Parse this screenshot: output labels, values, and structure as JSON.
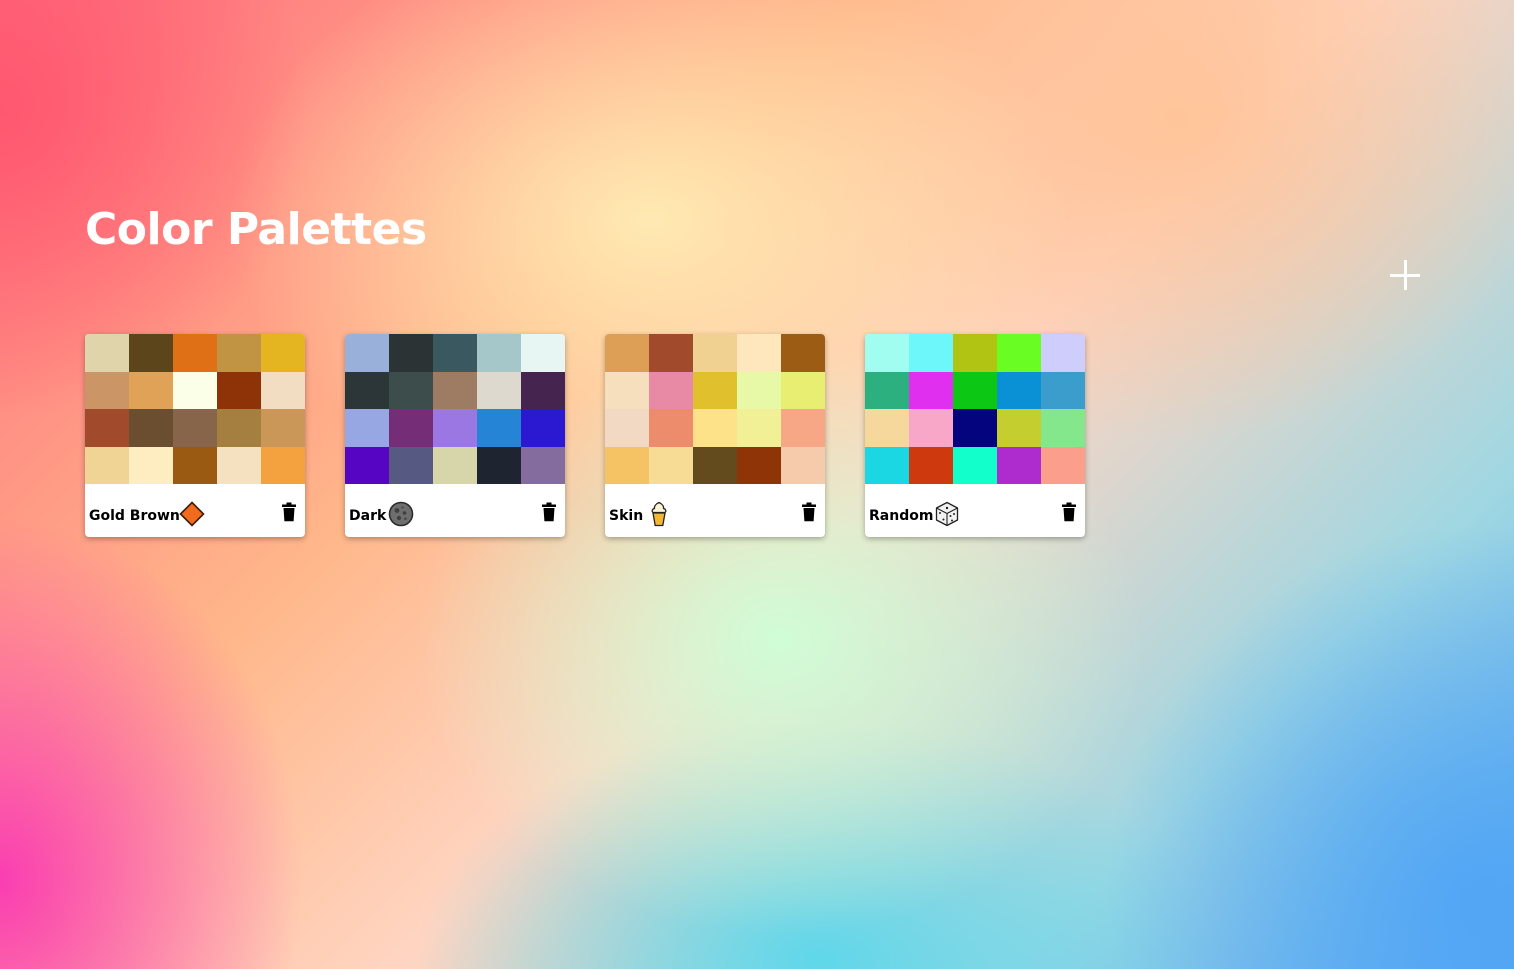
{
  "page": {
    "title": "Color Palettes"
  },
  "toolbar": {
    "add_icon": "plus-icon"
  },
  "palettes": [
    {
      "name": "Gold Brown",
      "emoji": "orange-diamond-icon",
      "colors": [
        "#e0d5aa",
        "#5c451b",
        "#e07016",
        "#c09442",
        "#e4b421",
        "#cb9566",
        "#dfa256",
        "#fbffe8",
        "#8e3308",
        "#f2dcc2",
        "#a24b2c",
        "#6b4e2f",
        "#87654a",
        "#a57f3f",
        "#cb9759",
        "#efd495",
        "#ffedc2",
        "#9a5a11",
        "#f5e0bf",
        "#f4a240"
      ]
    },
    {
      "name": "Dark",
      "emoji": "new-moon-icon",
      "colors": [
        "#98b0da",
        "#2c3334",
        "#3a5860",
        "#a6c7c9",
        "#e8f6f3",
        "#2c3538",
        "#3d4d4b",
        "#9e7c64",
        "#ded9cf",
        "#452450",
        "#97a7e4",
        "#742d76",
        "#9a77e2",
        "#2584d5",
        "#2b19d2",
        "#5606c3",
        "#565982",
        "#d7d6aa",
        "#1e2430",
        "#846d9e"
      ]
    },
    {
      "name": "Skin",
      "emoji": "soft-ice-cream-icon",
      "colors": [
        "#dc9f55",
        "#a24a2c",
        "#f0d192",
        "#ffe7bd",
        "#9c5c13",
        "#f6dfbd",
        "#e88aa6",
        "#e1c02e",
        "#e7f9a6",
        "#e8ee72",
        "#f2d9c3",
        "#ec8c6c",
        "#fee289",
        "#f1f097",
        "#f8a786",
        "#f6c364",
        "#f7dc95",
        "#644b1e",
        "#8e3406",
        "#f6cbab"
      ]
    },
    {
      "name": "Random",
      "emoji": "game-die-icon",
      "colors": [
        "#a1fdef",
        "#6ef7fb",
        "#b1c414",
        "#6afd23",
        "#cfcdfb",
        "#2cb07f",
        "#e12ff0",
        "#0cc713",
        "#0a90d5",
        "#3a9dcc",
        "#f6d89c",
        "#f8a7c8",
        "#05047f",
        "#c4ce2f",
        "#85e78c",
        "#1bd7e3",
        "#cf390e",
        "#12ffcb",
        "#ae2ccd",
        "#fb9e8b"
      ]
    }
  ]
}
